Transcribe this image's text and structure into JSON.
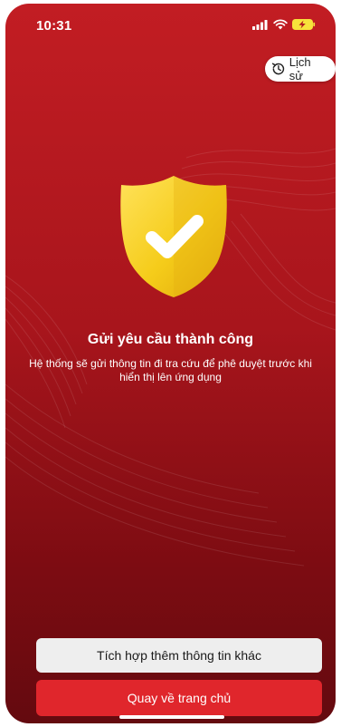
{
  "status_bar": {
    "time": "10:31",
    "icons": [
      "signal-icon",
      "wifi-icon",
      "battery-charging-icon"
    ]
  },
  "header": {
    "history_label": "Lịch sử",
    "history_icon": "history-clock-icon"
  },
  "result": {
    "icon": "shield-check-icon",
    "title": "Gửi yêu cầu thành công",
    "description_line1": "Hệ thống sẽ gửi thông tin đi tra cứu để phê duyệt trước khi",
    "description_line2": "hiển thị lên ứng dụng"
  },
  "actions": {
    "secondary_label": "Tích hợp thêm thông tin khác",
    "primary_label": "Quay về trang chủ"
  },
  "colors": {
    "background_top": "#c21d23",
    "background_bottom": "#640a0f",
    "primary_button": "#e0262c",
    "secondary_button": "#eeeeee",
    "shield": "#f5cc1a",
    "battery": "#f7e23b"
  }
}
